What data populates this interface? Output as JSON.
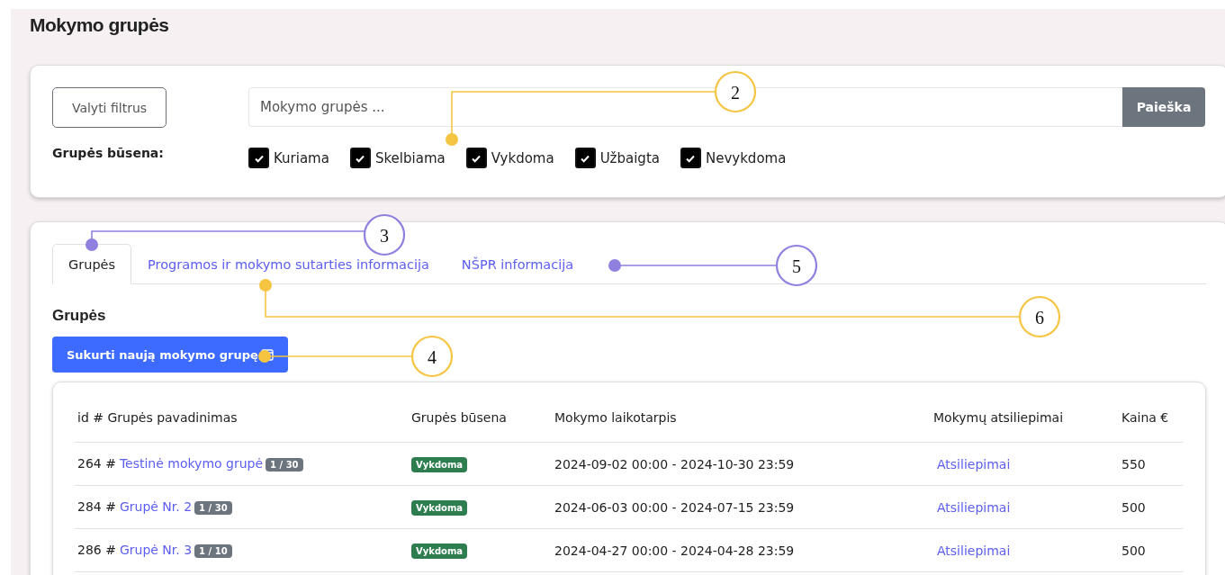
{
  "page_title": "Mokymo grupės",
  "filters": {
    "clear_button": "Valyti filtrus",
    "search": {
      "placeholder": "Mokymo grupės ...",
      "button": "Paieška"
    },
    "status_label": "Grupės būsena:",
    "statuses": [
      {
        "label": "Kuriama",
        "checked": true
      },
      {
        "label": "Skelbiama",
        "checked": true
      },
      {
        "label": "Vykdoma",
        "checked": true
      },
      {
        "label": "Užbaigta",
        "checked": true
      },
      {
        "label": "Nevykdoma",
        "checked": true
      }
    ]
  },
  "tabs": [
    {
      "label": "Grupės",
      "selected": true
    },
    {
      "label": "Programos ir mokymo sutarties informacija",
      "selected": false
    },
    {
      "label": "NŠPR informacija",
      "selected": false
    }
  ],
  "section_title": "Grupės",
  "create_button": "Sukurti naują mokymo grupę",
  "table": {
    "columns": [
      "id # Grupės pavadinimas",
      "Grupės būsena",
      "Mokymo laikotarpis",
      "Mokymų atsiliepimai",
      "Kaina €"
    ],
    "rows": [
      {
        "id": "264 #",
        "name": "Testinė mokymo grupė",
        "count": "1 / 30",
        "status": "Vykdoma",
        "period": "2024-09-02 00:00 - 2024-10-30 23:59",
        "feedback": "Atsiliepimai",
        "price": "550"
      },
      {
        "id": "284 #",
        "name": "Grupė Nr. 2",
        "count": "1 / 30",
        "status": "Vykdoma",
        "period": "2024-06-03 00:00 - 2024-07-15 23:59",
        "feedback": "Atsiliepimai",
        "price": "500"
      },
      {
        "id": "286 #",
        "name": "Grupė Nr. 3",
        "count": "1 / 10",
        "status": "Vykdoma",
        "period": "2024-04-27 00:00 - 2024-04-28 23:59",
        "feedback": "Atsiliepimai",
        "price": "500"
      }
    ]
  },
  "callouts": [
    {
      "label": "2",
      "color": "#f5c542"
    },
    {
      "label": "3",
      "color": "#8f80e0"
    },
    {
      "label": "5",
      "color": "#8f80e0"
    },
    {
      "label": "6",
      "color": "#f5c542"
    },
    {
      "label": "4",
      "color": "#f5c542"
    }
  ]
}
